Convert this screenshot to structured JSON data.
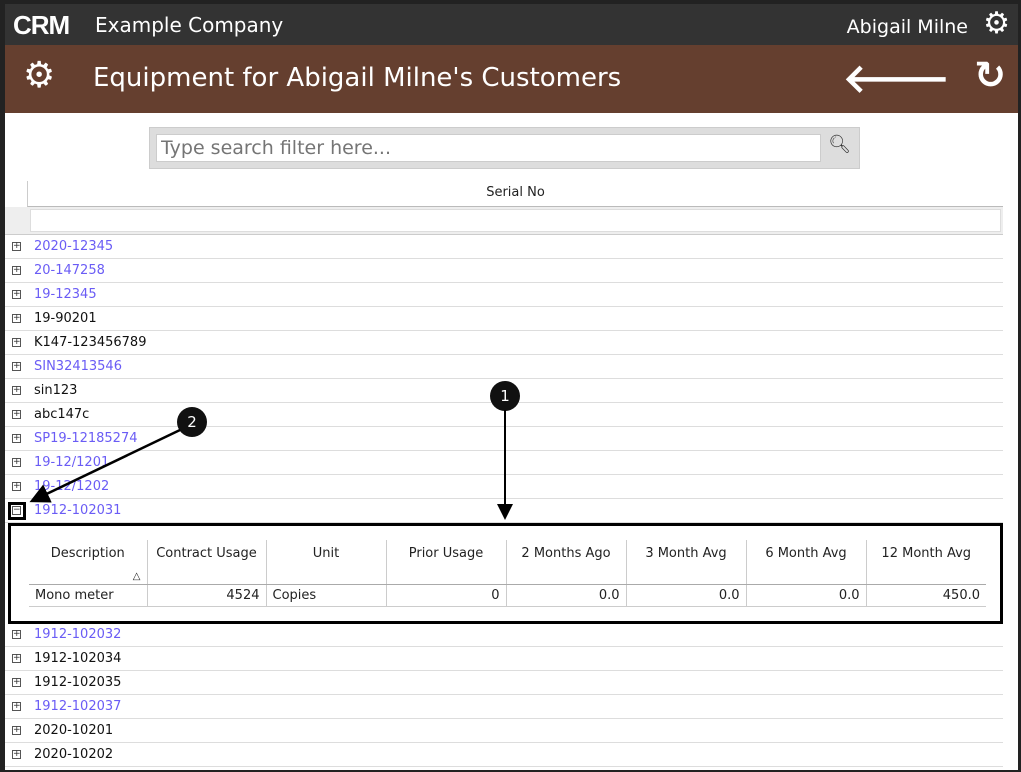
{
  "topbar": {
    "logo": "CRM",
    "company": "Example Company",
    "user": "Abigail Milne"
  },
  "titlebar": {
    "title": "Equipment for Abigail Milne's Customers"
  },
  "search": {
    "placeholder": "Type search filter here..."
  },
  "table": {
    "column": "Serial No",
    "rows_before": [
      {
        "sn": "2020-12345",
        "link": true
      },
      {
        "sn": "20-147258",
        "link": true
      },
      {
        "sn": "19-12345",
        "link": true
      },
      {
        "sn": "19-90201",
        "link": false
      },
      {
        "sn": "K147-123456789",
        "link": false
      },
      {
        "sn": "SIN32413546",
        "link": true
      },
      {
        "sn": "sin123",
        "link": false
      },
      {
        "sn": "abc147c",
        "link": false
      },
      {
        "sn": "SP19-12185274",
        "link": true
      },
      {
        "sn": "19-12/1201",
        "link": true
      },
      {
        "sn": "19-12/1202",
        "link": true
      }
    ],
    "expanded_row": {
      "sn": "1912-102031"
    },
    "rows_after": [
      {
        "sn": "1912-102032",
        "link": true
      },
      {
        "sn": "1912-102034",
        "link": false
      },
      {
        "sn": "1912-102035",
        "link": false
      },
      {
        "sn": "1912-102037",
        "link": true
      },
      {
        "sn": "2020-10201",
        "link": false
      },
      {
        "sn": "2020-10202",
        "link": false
      }
    ]
  },
  "detail": {
    "headers": [
      "Description",
      "Contract Usage",
      "Unit",
      "Prior Usage",
      "2 Months Ago",
      "3 Month Avg",
      "6 Month Avg",
      "12 Month Avg"
    ],
    "row": [
      "Mono meter",
      "4524",
      "Copies",
      "0",
      "0.0",
      "0.0",
      "0.0",
      "450.0"
    ]
  },
  "annotations": [
    "1",
    "2"
  ]
}
